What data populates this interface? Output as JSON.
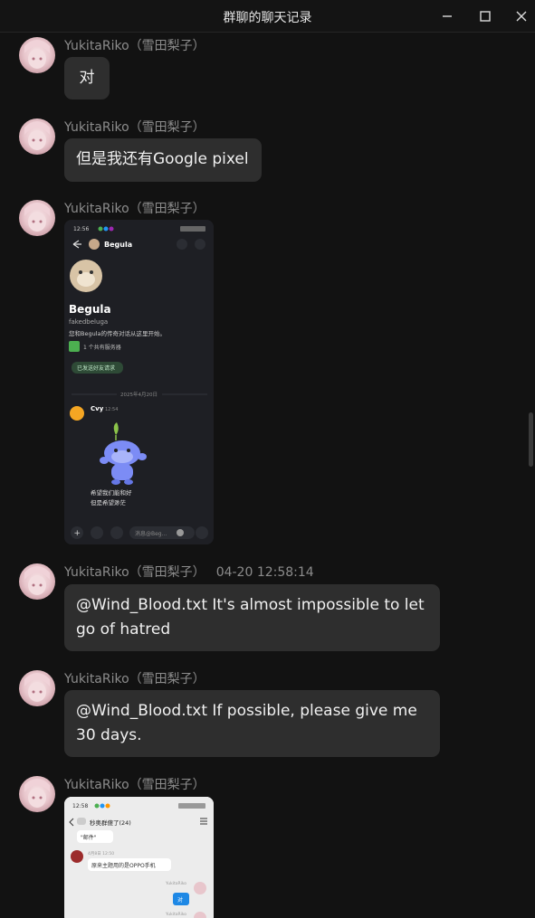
{
  "window": {
    "title": "群聊的聊天记录",
    "controls": [
      "minimize-icon",
      "maximize-icon",
      "close-icon"
    ]
  },
  "messages": [
    {
      "sender": "YukitaRiko（雪田梨子）",
      "time": "",
      "type": "text",
      "text": "对"
    },
    {
      "sender": "YukitaRiko（雪田梨子）",
      "time": "",
      "type": "text",
      "text": "但是我还有Google pixel"
    },
    {
      "sender": "YukitaRiko（雪田梨子）",
      "time": "",
      "type": "image",
      "screenshot": {
        "status_time": "12:56",
        "contact_name": "Begula",
        "username": "fakedbeluga",
        "intro": "您和Begula的传奇对话从这里开始。",
        "mutual": "1 个共有服务器",
        "friend_request": "已发送好友请求",
        "date_divider": "2025年4月20日",
        "msg_author": "Cvy",
        "msg_time": "12:54",
        "caption_1": "希望我们能和好",
        "caption_2": "但是希望渺茫",
        "input_placeholder": "消息@Beg..."
      }
    },
    {
      "sender": "YukitaRiko（雪田梨子）",
      "time": "04-20 12:58:14",
      "type": "text",
      "text_lines": [
        "@Wind_Blood.txt It's almost impossible to let",
        "go of hatred"
      ]
    },
    {
      "sender": "YukitaRiko（雪田梨子）",
      "time": "",
      "type": "text",
      "text_lines": [
        "@Wind_Blood.txt If possible, please give me",
        "30 days."
      ]
    },
    {
      "sender": "YukitaRiko（雪田梨子）",
      "time": "",
      "type": "image",
      "screenshot": {
        "status_time": "12:58",
        "group_title": "秒奥群傻了(24)",
        "quoted": "\"邮件\"",
        "sub_time": "4月8日 12:50",
        "bubble_text": "原来主题用的是OPPO手机",
        "right_name": "YukitaRiko",
        "right_bubble": "对"
      }
    }
  ],
  "colors": {
    "background": "#121212",
    "bubble": "#2e2e2e",
    "sender_text": "#8c8c8c",
    "discord_bg": "#1e1f24",
    "wumpus_blue": "#7c8cf5",
    "qq_bubble_blue": "#1e88e5"
  }
}
